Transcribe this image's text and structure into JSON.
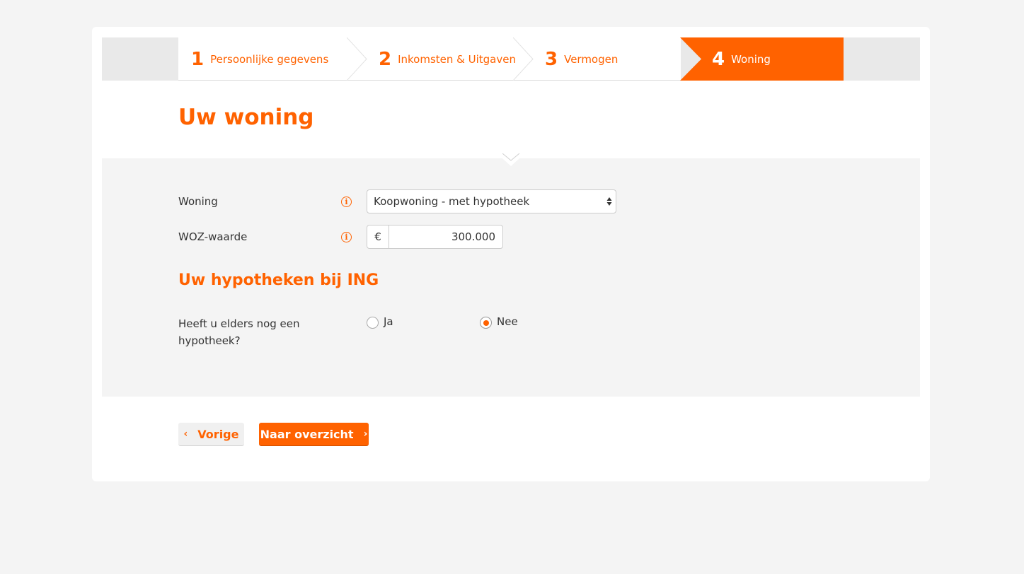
{
  "steps": [
    {
      "num": "1",
      "label": "Persoonlijke gegevens"
    },
    {
      "num": "2",
      "label": "Inkomsten & Uitgaven"
    },
    {
      "num": "3",
      "label": "Vermogen"
    },
    {
      "num": "4",
      "label": "Woning"
    }
  ],
  "active_step": 4,
  "page_title": "Uw woning",
  "form": {
    "woning": {
      "label": "Woning",
      "value": "Koopwoning - met hypotheek"
    },
    "woz": {
      "label": "WOZ-waarde",
      "currency": "€",
      "value": "300.000"
    }
  },
  "section_title": "Uw hypotheken bij ING",
  "question": {
    "label": "Heeft u elders nog een hypotheek?",
    "options": [
      {
        "label": "Ja",
        "selected": false
      },
      {
        "label": "Nee",
        "selected": true
      }
    ]
  },
  "buttons": {
    "prev": "Vorige",
    "next": "Naar overzicht"
  },
  "colors": {
    "accent": "#ff6200",
    "background": "#f4f4f4",
    "card": "#ffffff"
  },
  "icons": {
    "info": "info-icon",
    "chevron_left": "chevron-left-icon",
    "chevron_right": "chevron-right-icon",
    "select_arrows": "select-arrows-icon"
  }
}
